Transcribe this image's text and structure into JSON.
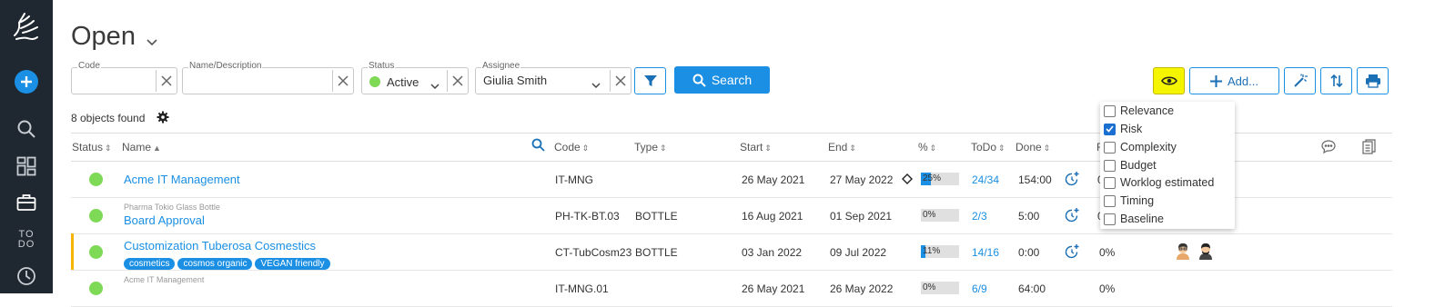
{
  "page": {
    "title": "Open"
  },
  "sidebar": {
    "todo_label_1": "TO",
    "todo_label_2": "DO"
  },
  "filters": {
    "code": {
      "label": "Code",
      "value": ""
    },
    "name": {
      "label": "Name/Description",
      "value": ""
    },
    "status": {
      "label": "Status",
      "value": "Active"
    },
    "assignee": {
      "label": "Assignee",
      "value": "Giulia Smith"
    }
  },
  "search_button": "Search",
  "toolbar": {
    "add_label": "Add..."
  },
  "results": {
    "count_text": "8 objects found"
  },
  "columns": {
    "status": "Status",
    "name": "Name",
    "code": "Code",
    "type": "Type",
    "start": "Start",
    "end": "End",
    "percent": "%",
    "todo": "ToDo",
    "done": "Done",
    "r": "R"
  },
  "rows": [
    {
      "parent": "",
      "name": "Acme IT Management",
      "code": "IT-MNG",
      "type": "",
      "start": "26 May 2021",
      "end": "27 May 2022",
      "percent": "25%",
      "progress": 0.25,
      "todo": "24/34",
      "done": "154:00",
      "extra": "0",
      "tags": []
    },
    {
      "parent": "Pharma Tokio Glass Bottle",
      "name": "Board Approval",
      "code": "PH-TK-BT.03",
      "type": "BOTTLE",
      "start": "16 Aug 2021",
      "end": "01 Sep 2021",
      "percent": "0%",
      "progress": 0,
      "todo": "2/3",
      "done": "5:00",
      "extra": "0",
      "tags": []
    },
    {
      "parent": "",
      "name": "Customization Tuberosa Cosmestics",
      "code": "CT-TubCosm23",
      "type": "BOTTLE",
      "start": "03 Jan 2022",
      "end": "09 Jul 2022",
      "percent": "11%",
      "progress": 0.11,
      "todo": "14/16",
      "done": "0:00",
      "extra": "0%",
      "tags": [
        "cosmetics",
        "cosmos organic",
        "VEGAN friendly"
      ]
    },
    {
      "parent": "Acme IT Management",
      "name": "",
      "code": "IT-MNG.01",
      "type": "",
      "start": "26 May 2021",
      "end": "26 May 2022",
      "percent": "0%",
      "progress": 0,
      "todo": "6/9",
      "done": "64:00",
      "extra": "0%",
      "tags": []
    }
  ],
  "column_menu": [
    {
      "label": "Relevance",
      "checked": false
    },
    {
      "label": "Risk",
      "checked": true
    },
    {
      "label": "Complexity",
      "checked": false
    },
    {
      "label": "Budget",
      "checked": false
    },
    {
      "label": "Worklog estimated",
      "checked": false
    },
    {
      "label": "Timing",
      "checked": false
    },
    {
      "label": "Baseline",
      "checked": false
    }
  ],
  "colors": {
    "accent": "#1a8fe3",
    "sidebar": "#1f2730",
    "status_green": "#7ed957",
    "highlight": "#f5f500",
    "row_flag": "#f4b400"
  }
}
